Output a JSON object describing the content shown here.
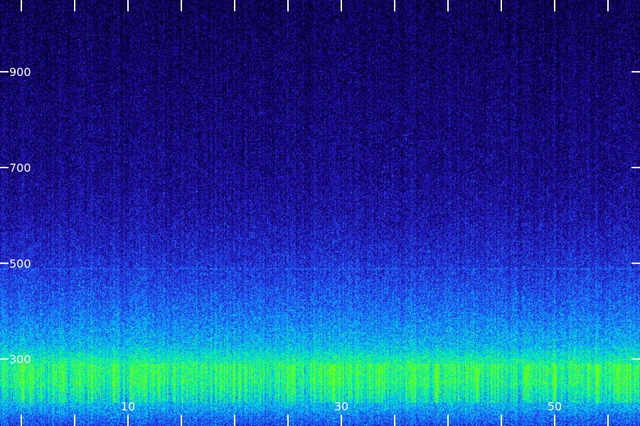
{
  "chart_data": {
    "type": "heatmap",
    "title": "",
    "xlabel": "",
    "ylabel": "",
    "xlim": [
      -2,
      58
    ],
    "ylim": [
      160,
      1050
    ],
    "x_ticks": [
      0,
      5,
      10,
      15,
      20,
      25,
      30,
      35,
      40,
      45,
      50,
      55
    ],
    "x_tick_labels": [
      {
        "value": 10,
        "label": "10"
      },
      {
        "value": 30,
        "label": "30"
      },
      {
        "value": 50,
        "label": "50"
      }
    ],
    "y_ticks": [
      {
        "value": 300,
        "label": "300"
      },
      {
        "value": 500,
        "label": "500"
      },
      {
        "value": 700,
        "label": "700"
      },
      {
        "value": 900,
        "label": "900"
      }
    ],
    "colormap": [
      "#000014",
      "#14006e",
      "#2a1ad0",
      "#1e64ff",
      "#00c8ff",
      "#00ff96",
      "#7dff00"
    ],
    "intensity_profile": [
      {
        "y": 1050,
        "level": 0.1
      },
      {
        "y": 900,
        "level": 0.14
      },
      {
        "y": 700,
        "level": 0.2
      },
      {
        "y": 600,
        "level": 0.26
      },
      {
        "y": 500,
        "level": 0.36
      },
      {
        "y": 400,
        "level": 0.5
      },
      {
        "y": 330,
        "level": 0.64
      },
      {
        "y": 290,
        "level": 0.82
      },
      {
        "y": 250,
        "level": 0.8
      },
      {
        "y": 200,
        "level": 0.62
      },
      {
        "y": 160,
        "level": 0.42
      }
    ],
    "horizontal_lines": [
      {
        "y": 490,
        "level": 0.45
      }
    ],
    "bright_band_y_range": [
      210,
      290
    ]
  }
}
